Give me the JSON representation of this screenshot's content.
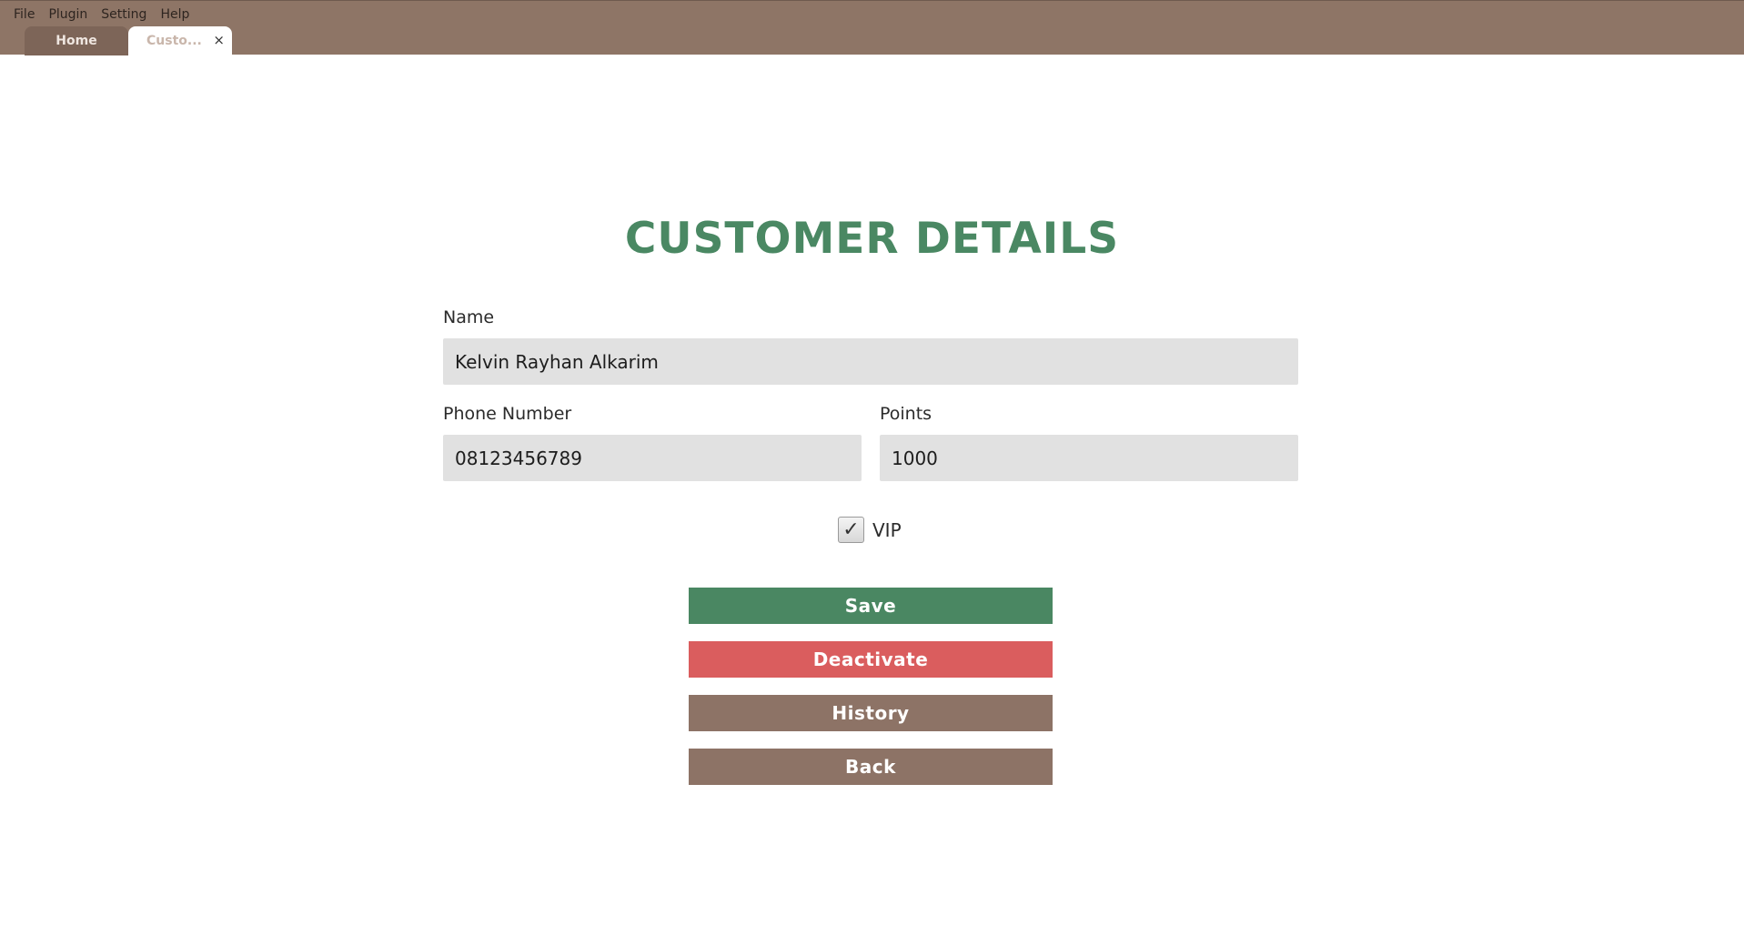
{
  "menu": [
    "File",
    "Plugin",
    "Setting",
    "Help"
  ],
  "tabs": {
    "home": "Home",
    "customer": "Custo...",
    "close_glyph": "×"
  },
  "page": {
    "title": "CUSTOMER DETAILS"
  },
  "form": {
    "name_label": "Name",
    "name_value": "Kelvin Rayhan Alkarim",
    "phone_label": "Phone Number",
    "phone_value": "08123456789",
    "points_label": "Points",
    "points_value": "1000",
    "vip_label": "VIP",
    "vip_checked": true,
    "check_glyph": "✓"
  },
  "buttons": {
    "save": "Save",
    "deactivate": "Deactivate",
    "history": "History",
    "back": "Back"
  },
  "colors": {
    "topbar": "#8e7566",
    "title": "#4a8863",
    "save": "#4a8762",
    "deactivate": "#da5d5e",
    "neutral": "#8d7366"
  }
}
